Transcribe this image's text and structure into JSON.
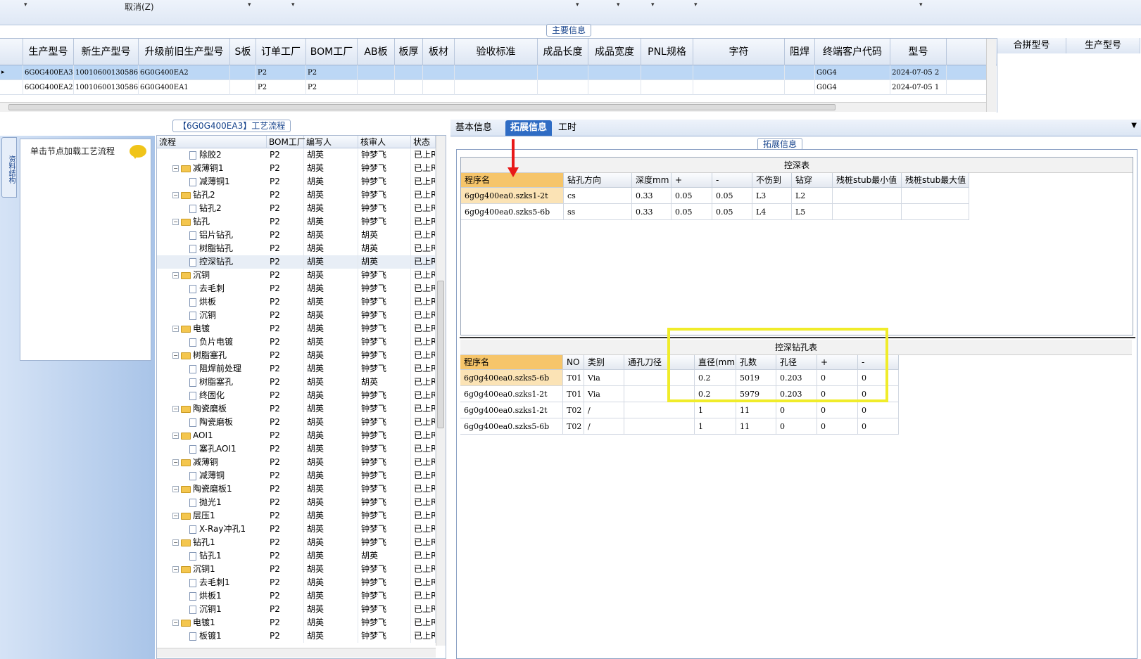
{
  "toolbar": {
    "cancel_label": "取消(Z)"
  },
  "main_group_caption": "主要信息",
  "main_grid": {
    "columns": [
      "生产型号",
      "新生产型号",
      "升级前旧生产型号",
      "S板",
      "订单工厂",
      "BOM工厂",
      "AB板",
      "板厚",
      "板材",
      "验收标准",
      "成品长度",
      "成品宽度",
      "PNL规格",
      "字符",
      "阻焊",
      "终端客户代码",
      "型号"
    ],
    "rows": [
      [
        "6G0G400EA3",
        "10010600130586",
        "6G0G400EA2",
        "",
        "P2",
        "P2",
        "",
        "",
        "",
        "",
        "",
        "",
        "",
        "",
        "",
        "G0G4",
        "2024-07-05 2"
      ],
      [
        "6G0G400EA2",
        "10010600130586",
        "6G0G400EA1",
        "",
        "P2",
        "P2",
        "",
        "",
        "",
        "",
        "",
        "",
        "",
        "",
        "",
        "G0G4",
        "2024-07-05 1"
      ]
    ]
  },
  "merge_panel": {
    "columns": [
      "合拼型号",
      "生产型号"
    ]
  },
  "left_nav": {
    "vertical_tab": "资料结构",
    "load_hint": "单击节点加载工艺流程"
  },
  "process_caption": "【6G0G400EA3】工艺流程",
  "process_tree": {
    "columns": [
      "流程",
      "BOM工厂",
      "编写人",
      "核审人",
      "状态"
    ],
    "rows": [
      {
        "name": "除胶2",
        "level": 2,
        "type": "doc",
        "bom": "P2",
        "writer": "胡英",
        "reviewer": "钟梦飞",
        "status": "已上R"
      },
      {
        "name": "减薄铜1",
        "level": 1,
        "type": "folder",
        "bom": "P2",
        "writer": "胡英",
        "reviewer": "钟梦飞",
        "status": "已上R"
      },
      {
        "name": "减薄铜1",
        "level": 2,
        "type": "doc",
        "bom": "P2",
        "writer": "胡英",
        "reviewer": "钟梦飞",
        "status": "已上R"
      },
      {
        "name": "钻孔2",
        "level": 1,
        "type": "folder",
        "bom": "P2",
        "writer": "胡英",
        "reviewer": "钟梦飞",
        "status": "已上R"
      },
      {
        "name": "钻孔2",
        "level": 2,
        "type": "doc",
        "bom": "P2",
        "writer": "胡英",
        "reviewer": "钟梦飞",
        "status": "已上R"
      },
      {
        "name": "钻孔",
        "level": 1,
        "type": "folder",
        "bom": "P2",
        "writer": "胡英",
        "reviewer": "钟梦飞",
        "status": "已上R"
      },
      {
        "name": "铝片钻孔",
        "level": 2,
        "type": "doc",
        "bom": "P2",
        "writer": "胡英",
        "reviewer": "胡英",
        "status": "已上R"
      },
      {
        "name": "树脂钻孔",
        "level": 2,
        "type": "doc",
        "bom": "P2",
        "writer": "胡英",
        "reviewer": "胡英",
        "status": "已上R"
      },
      {
        "name": "控深钻孔",
        "level": 2,
        "type": "doc",
        "bom": "P2",
        "writer": "胡英",
        "reviewer": "胡英",
        "status": "已上R"
      },
      {
        "name": "沉铜",
        "level": 1,
        "type": "folder",
        "bom": "P2",
        "writer": "胡英",
        "reviewer": "钟梦飞",
        "status": "已上R"
      },
      {
        "name": "去毛刺",
        "level": 2,
        "type": "doc",
        "bom": "P2",
        "writer": "胡英",
        "reviewer": "钟梦飞",
        "status": "已上R"
      },
      {
        "name": "烘板",
        "level": 2,
        "type": "doc",
        "bom": "P2",
        "writer": "胡英",
        "reviewer": "钟梦飞",
        "status": "已上R"
      },
      {
        "name": "沉铜",
        "level": 2,
        "type": "doc",
        "bom": "P2",
        "writer": "胡英",
        "reviewer": "钟梦飞",
        "status": "已上R"
      },
      {
        "name": "电镀",
        "level": 1,
        "type": "folder",
        "bom": "P2",
        "writer": "胡英",
        "reviewer": "钟梦飞",
        "status": "已上R"
      },
      {
        "name": "负片电镀",
        "level": 2,
        "type": "doc",
        "bom": "P2",
        "writer": "胡英",
        "reviewer": "钟梦飞",
        "status": "已上R"
      },
      {
        "name": "树脂塞孔",
        "level": 1,
        "type": "folder",
        "bom": "P2",
        "writer": "胡英",
        "reviewer": "钟梦飞",
        "status": "已上R"
      },
      {
        "name": "阻焊前处理",
        "level": 2,
        "type": "doc",
        "bom": "P2",
        "writer": "胡英",
        "reviewer": "钟梦飞",
        "status": "已上R"
      },
      {
        "name": "树脂塞孔",
        "level": 2,
        "type": "doc",
        "bom": "P2",
        "writer": "胡英",
        "reviewer": "胡英",
        "status": "已上R"
      },
      {
        "name": "终固化",
        "level": 2,
        "type": "doc",
        "bom": "P2",
        "writer": "胡英",
        "reviewer": "钟梦飞",
        "status": "已上R"
      },
      {
        "name": "陶瓷磨板",
        "level": 1,
        "type": "folder",
        "bom": "P2",
        "writer": "胡英",
        "reviewer": "钟梦飞",
        "status": "已上R"
      },
      {
        "name": "陶瓷磨板",
        "level": 2,
        "type": "doc",
        "bom": "P2",
        "writer": "胡英",
        "reviewer": "钟梦飞",
        "status": "已上R"
      },
      {
        "name": "AOI1",
        "level": 1,
        "type": "folder",
        "bom": "P2",
        "writer": "胡英",
        "reviewer": "钟梦飞",
        "status": "已上R"
      },
      {
        "name": "塞孔AOI1",
        "level": 2,
        "type": "doc",
        "bom": "P2",
        "writer": "胡英",
        "reviewer": "钟梦飞",
        "status": "已上R"
      },
      {
        "name": "减薄铜",
        "level": 1,
        "type": "folder",
        "bom": "P2",
        "writer": "胡英",
        "reviewer": "钟梦飞",
        "status": "已上R"
      },
      {
        "name": "减薄铜",
        "level": 2,
        "type": "doc",
        "bom": "P2",
        "writer": "胡英",
        "reviewer": "钟梦飞",
        "status": "已上R"
      },
      {
        "name": "陶瓷磨板1",
        "level": 1,
        "type": "folder",
        "bom": "P2",
        "writer": "胡英",
        "reviewer": "钟梦飞",
        "status": "已上R"
      },
      {
        "name": "抛光1",
        "level": 2,
        "type": "doc",
        "bom": "P2",
        "writer": "胡英",
        "reviewer": "钟梦飞",
        "status": "已上R"
      },
      {
        "name": "层压1",
        "level": 1,
        "type": "folder",
        "bom": "P2",
        "writer": "胡英",
        "reviewer": "钟梦飞",
        "status": "已上R"
      },
      {
        "name": "X-Ray冲孔1",
        "level": 2,
        "type": "doc",
        "bom": "P2",
        "writer": "胡英",
        "reviewer": "钟梦飞",
        "status": "已上R"
      },
      {
        "name": "钻孔1",
        "level": 1,
        "type": "folder",
        "bom": "P2",
        "writer": "胡英",
        "reviewer": "钟梦飞",
        "status": "已上R"
      },
      {
        "name": "钻孔1",
        "level": 2,
        "type": "doc",
        "bom": "P2",
        "writer": "胡英",
        "reviewer": "胡英",
        "status": "已上R"
      },
      {
        "name": "沉铜1",
        "level": 1,
        "type": "folder",
        "bom": "P2",
        "writer": "胡英",
        "reviewer": "钟梦飞",
        "status": "已上R"
      },
      {
        "name": "去毛刺1",
        "level": 2,
        "type": "doc",
        "bom": "P2",
        "writer": "胡英",
        "reviewer": "钟梦飞",
        "status": "已上R"
      },
      {
        "name": "烘板1",
        "level": 2,
        "type": "doc",
        "bom": "P2",
        "writer": "胡英",
        "reviewer": "钟梦飞",
        "status": "已上R"
      },
      {
        "name": "沉铜1",
        "level": 2,
        "type": "doc",
        "bom": "P2",
        "writer": "胡英",
        "reviewer": "钟梦飞",
        "status": "已上R"
      },
      {
        "name": "电镀1",
        "level": 1,
        "type": "folder",
        "bom": "P2",
        "writer": "胡英",
        "reviewer": "钟梦飞",
        "status": "已上R"
      },
      {
        "name": "板镀1",
        "level": 2,
        "type": "doc",
        "bom": "P2",
        "writer": "胡英",
        "reviewer": "钟梦飞",
        "status": "已上R"
      }
    ]
  },
  "tabs": [
    {
      "label": "基本信息",
      "active": false
    },
    {
      "label": "拓展信息",
      "active": true
    },
    {
      "label": "工时",
      "active": false
    }
  ],
  "ext_caption": "拓展信息",
  "depth_table": {
    "title": "控深表",
    "columns": [
      "程序名",
      "钻孔方向",
      "深度mm",
      "+",
      "-",
      "不伤到",
      "钻穿",
      "残桩stub最小值",
      "残桩stub最大值"
    ],
    "rows": [
      [
        "6g0g400ea0.szks1-2t",
        "cs",
        "0.33",
        "0.05",
        "0.05",
        "L3",
        "L2",
        "",
        ""
      ],
      [
        "6g0g400ea0.szks5-6b",
        "ss",
        "0.33",
        "0.05",
        "0.05",
        "L4",
        "L5",
        "",
        ""
      ]
    ]
  },
  "drill_table": {
    "title": "控深钻孔表",
    "columns": [
      "程序名",
      "NO",
      "类别",
      "通孔刀径",
      "直径(mm)",
      "孔数",
      "孔径",
      "+",
      "-"
    ],
    "rows": [
      [
        "6g0g400ea0.szks5-6b",
        "T01",
        "Via",
        "",
        "0.2",
        "5019",
        "0.203",
        "0",
        "0"
      ],
      [
        "6g0g400ea0.szks1-2t",
        "T01",
        "Via",
        "",
        "0.2",
        "5979",
        "0.203",
        "0",
        "0"
      ],
      [
        "6g0g400ea0.szks1-2t",
        "T02",
        "/",
        "",
        "1",
        "11",
        "0",
        "0",
        "0"
      ],
      [
        "6g0g400ea0.szks5-6b",
        "T02",
        "/",
        "",
        "1",
        "11",
        "0",
        "0",
        "0"
      ]
    ]
  },
  "colors": {
    "accent": "#2f6cc4",
    "highlight_box": "#f0ec2a",
    "arrow": "#e81818",
    "header_orange": "#f6c56a"
  }
}
